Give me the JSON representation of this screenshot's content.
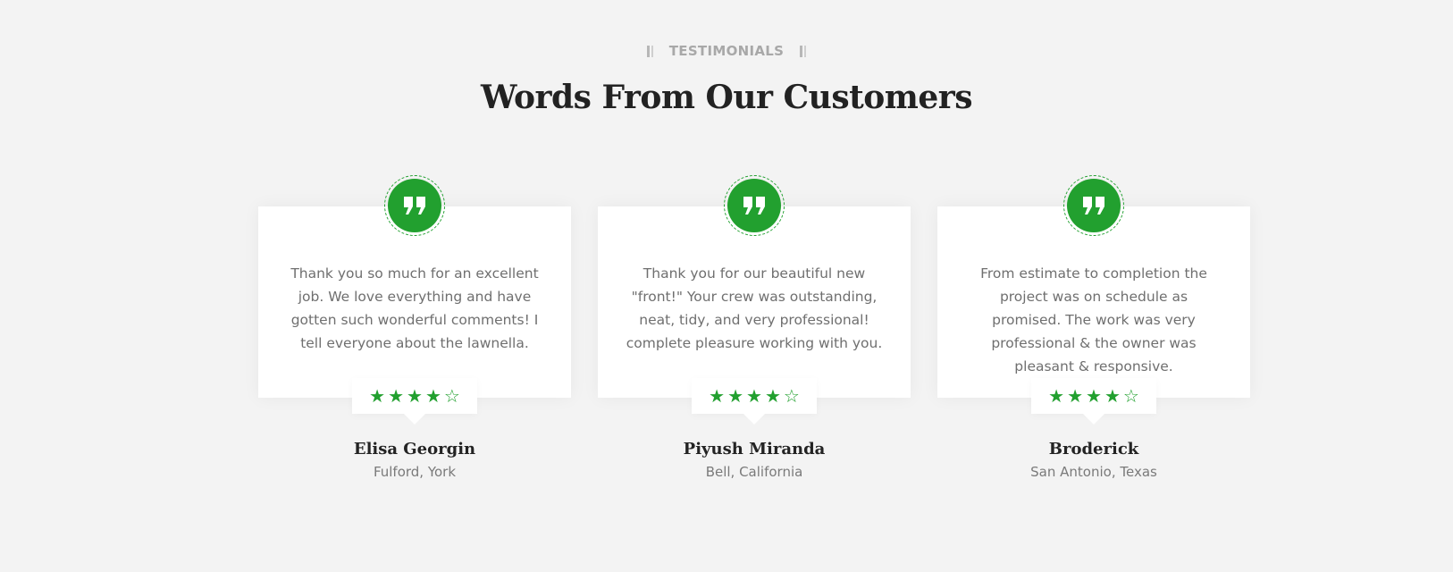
{
  "header": {
    "eyebrow": "TESTIMONIALS",
    "title": "Words From Our Customers"
  },
  "colors": {
    "background": "#f3f3f3",
    "accent": "#22a02f",
    "card": "#ffffff"
  },
  "testimonials": [
    {
      "icon": "quote-icon",
      "text": "Thank you so much for an excellent job. We love everything and have gotten such wonderful comments! I tell everyone about the lawnella.",
      "rating": 4,
      "rating_max": 5,
      "name": "Elisa Georgin",
      "location": "Fulford, York"
    },
    {
      "icon": "quote-icon",
      "text": "Thank you for our beautiful new \"front!\" Your crew was outstanding, neat, tidy, and very professional! complete pleasure working with you.",
      "rating": 4,
      "rating_max": 5,
      "name": "Piyush Miranda",
      "location": "Bell, California"
    },
    {
      "icon": "quote-icon",
      "text": "From estimate to completion the project was on schedule as promised. The work was very professional & the owner was pleasant & responsive.",
      "rating": 4,
      "rating_max": 5,
      "name": "Broderick",
      "location": "San Antonio, Texas"
    }
  ]
}
